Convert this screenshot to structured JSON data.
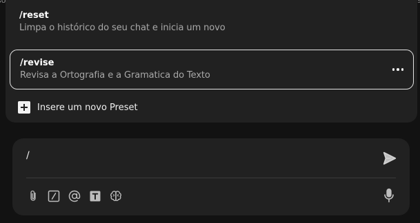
{
  "background": {
    "left_fragment": "so",
    "right_fragment": "s"
  },
  "preset_menu": {
    "items": [
      {
        "command": "/reset",
        "description": "Limpa o histórico do seu chat e inicia um novo",
        "selected": false
      },
      {
        "command": "/revise",
        "description": "Revisa a Ortografia e a Gramatica do Texto",
        "selected": true
      }
    ],
    "more_icon": "more-horizontal-icon",
    "add_preset_icon": "plus-square-icon",
    "add_preset_label": "Insere um novo Preset"
  },
  "chat": {
    "input_value": "/",
    "send_icon": "send-icon",
    "tools": [
      {
        "name": "attach",
        "icon": "paperclip-icon"
      },
      {
        "name": "slash-command",
        "icon": "slash-box-icon"
      },
      {
        "name": "mention",
        "icon": "at-icon"
      },
      {
        "name": "text-format",
        "icon": "text-box-icon"
      },
      {
        "name": "brain",
        "icon": "brain-icon"
      }
    ],
    "mic_icon": "microphone-icon"
  },
  "colors": {
    "page_background": "#121212",
    "panel": "#212121",
    "text_primary": "#ffffff",
    "text_secondary": "#a8a8a8",
    "selected_border": "#e6e6e6"
  }
}
